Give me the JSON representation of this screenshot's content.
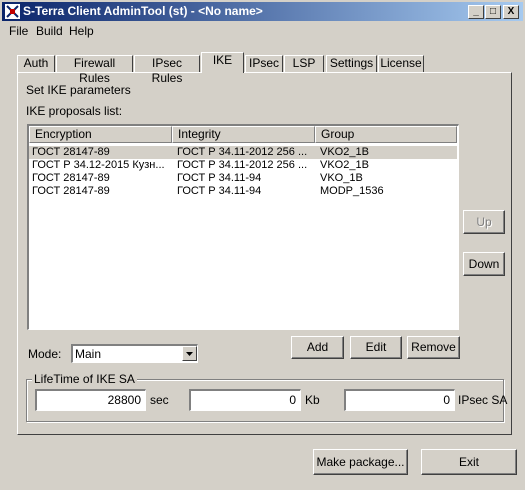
{
  "window": {
    "title": "S-Terra Client AdminTool (st) - <No name>",
    "controls": [
      "_",
      "□",
      "X"
    ]
  },
  "menu": [
    "File",
    "Build",
    "Help"
  ],
  "tabs": [
    {
      "label": "Auth",
      "active": false
    },
    {
      "label": "Firewall Rules",
      "active": false
    },
    {
      "label": "IPsec Rules",
      "active": false
    },
    {
      "label": "IKE",
      "active": true
    },
    {
      "label": "IPsec",
      "active": false
    },
    {
      "label": "LSP",
      "active": false
    },
    {
      "label": "Settings",
      "active": false
    },
    {
      "label": "License",
      "active": false
    }
  ],
  "ike": {
    "section_title": "Set IKE parameters",
    "proposals_label": "IKE proposals list:",
    "columns": [
      "Encryption",
      "Integrity",
      "Group"
    ],
    "rows": [
      {
        "encryption": "ГОСТ 28147-89",
        "integrity": "ГОСТ Р 34.11-2012 256 ...",
        "group": "VKO2_1B",
        "selected": true
      },
      {
        "encryption": "ГОСТ Р 34.12-2015 Кузн...",
        "integrity": "ГОСТ Р 34.11-2012 256 ...",
        "group": "VKO2_1B",
        "selected": false
      },
      {
        "encryption": "ГОСТ 28147-89",
        "integrity": "ГОСТ Р 34.11-94",
        "group": "VKO_1B",
        "selected": false
      },
      {
        "encryption": "ГОСТ 28147-89",
        "integrity": "ГОСТ Р 34.11-94",
        "group": "MODP_1536",
        "selected": false
      }
    ],
    "up_label": "Up",
    "down_label": "Down",
    "add_label": "Add",
    "edit_label": "Edit",
    "remove_label": "Remove",
    "mode_label": "Mode:",
    "mode_value": "Main",
    "lifetime": {
      "title": "LifeTime of IKE SA",
      "seconds": "28800",
      "seconds_unit": "sec",
      "kilobytes": "0",
      "kilobytes_unit": "Kb",
      "packets": "0",
      "packets_unit": "IPsec SA"
    }
  },
  "footer": {
    "make_package_label": "Make package...",
    "exit_label": "Exit"
  }
}
